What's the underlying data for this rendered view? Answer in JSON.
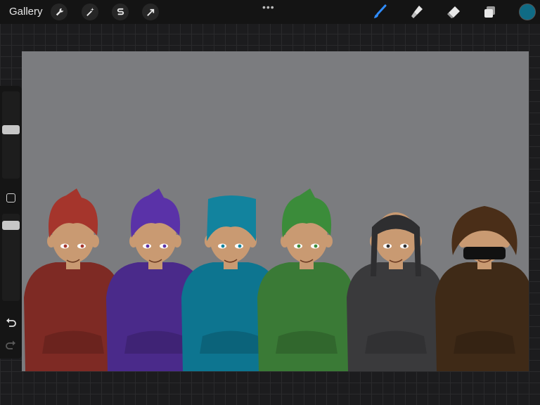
{
  "toolbar": {
    "gallery_label": "Gallery",
    "left_tools": [
      "wrench-icon",
      "magic-wand-icon",
      "selection-s-icon",
      "transform-arrow-icon"
    ],
    "more_menu": "•••",
    "right_tools": [
      "brush-icon",
      "smudge-icon",
      "eraser-icon",
      "layers-icon"
    ],
    "active_tool": "brush-icon",
    "active_tool_color": "#2f8cff",
    "current_color": "#0f6b85"
  },
  "sidebar": {
    "brush_size_level": 0.3,
    "opacity_level": 0.4,
    "controls": [
      "modify-button",
      "undo-icon",
      "redo-icon"
    ]
  },
  "canvas": {
    "background": "#7b7c7f",
    "figures": [
      {
        "hoodie": "#7e2a24",
        "hair": "#a5352c"
      },
      {
        "hoodie": "#4a2a8a",
        "hair": "#5a32a8"
      },
      {
        "hoodie": "#0d7590",
        "hair": "#12839e"
      },
      {
        "hoodie": "#3a7a36",
        "hair": "#3b8c3a"
      },
      {
        "hoodie": "#3a3a3c",
        "hair": "#2e2e30"
      },
      {
        "hoodie": "#3f2a17",
        "hair": "#4a2e18"
      }
    ],
    "skin": "#c99a72"
  }
}
